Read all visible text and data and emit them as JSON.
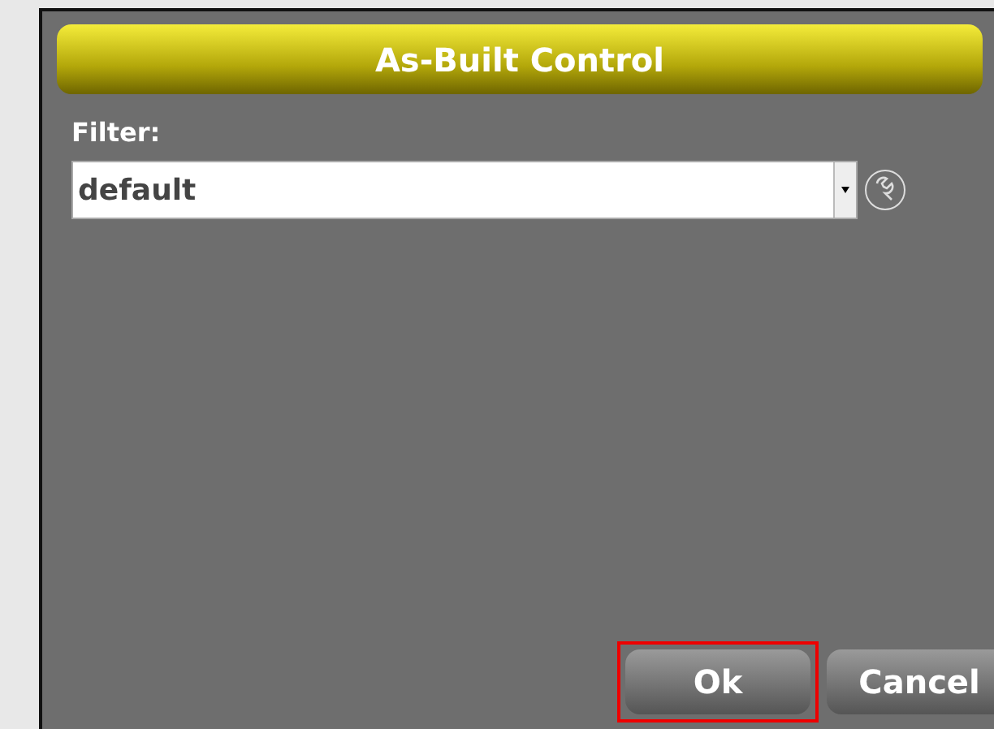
{
  "dialog": {
    "title": "As-Built Control"
  },
  "filter": {
    "label": "Filter:",
    "value": "default"
  },
  "buttons": [
    {
      "label": "Ok",
      "highlighted": true
    },
    {
      "label": "Cancel",
      "highlighted": false
    }
  ]
}
